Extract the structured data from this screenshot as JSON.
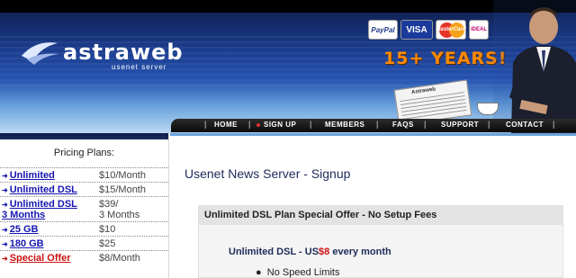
{
  "brand": {
    "name": "astraweb",
    "tagline": "usenet server"
  },
  "payments": {
    "paypal": "PayPal",
    "visa": "VISA",
    "mastercard": "MasterCard",
    "ideal": "iDEAL"
  },
  "promo": {
    "years": "15+ YEARS!"
  },
  "newspaper": {
    "title": "Astraweb"
  },
  "nav": {
    "items": [
      "HOME",
      "SIGN UP",
      "MEMBERS",
      "FAQS",
      "SUPPORT",
      "CONTACT"
    ],
    "active": "SIGN UP"
  },
  "sidebar": {
    "title": "Pricing Plans:",
    "plans": [
      {
        "name": "Unlimited",
        "price": "$10/Month"
      },
      {
        "name": "Unlimited DSL",
        "price": "$15/Month"
      },
      {
        "name": "Unlimited DSL",
        "name2": "3 Months",
        "price": "$39/",
        "price2": "3 Months"
      },
      {
        "name": "25 GB",
        "price": "$10"
      },
      {
        "name": "180 GB",
        "price": "$25"
      },
      {
        "name": "Special Offer",
        "price": "$8/Month"
      }
    ]
  },
  "main": {
    "heading": "Usenet News Server - Signup",
    "offer": {
      "header": "Unlimited DSL Plan Special Offer - No Setup Fees",
      "line_prefix": "Unlimited DSL - US",
      "line_price": "$8",
      "line_suffix": " every month",
      "bullet": "No Speed Limits"
    }
  },
  "colors": {
    "banner_dark": "#0d1b45",
    "banner_light": "#6aa3dd",
    "link": "#1515b0",
    "special": "#cc1111",
    "years": "#ff8a00"
  }
}
